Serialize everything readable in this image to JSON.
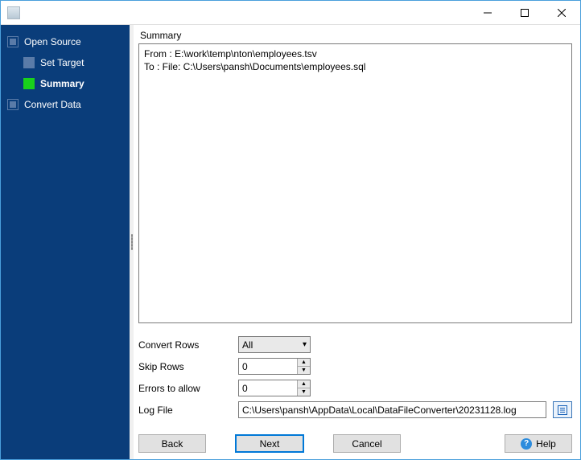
{
  "titlebar": {
    "title": ""
  },
  "sidebar": {
    "items": [
      {
        "label": "Open Source",
        "active": false,
        "child": false
      },
      {
        "label": "Set Target",
        "active": false,
        "child": true
      },
      {
        "label": "Summary",
        "active": true,
        "child": true
      },
      {
        "label": "Convert Data",
        "active": false,
        "child": false
      }
    ]
  },
  "main": {
    "section_label": "Summary",
    "summary_lines": {
      "line0": "From : E:\\work\\temp\\nton\\employees.tsv",
      "line1": "To : File: C:\\Users\\pansh\\Documents\\employees.sql"
    },
    "form": {
      "convert_rows": {
        "label": "Convert Rows",
        "value": "All"
      },
      "skip_rows": {
        "label": "Skip Rows",
        "value": "0"
      },
      "errors_allow": {
        "label": "Errors to allow",
        "value": "0"
      },
      "log_file": {
        "label": "Log File",
        "value": "C:\\Users\\pansh\\AppData\\Local\\DataFileConverter\\20231128.log"
      }
    }
  },
  "buttons": {
    "back": "Back",
    "next": "Next",
    "cancel": "Cancel",
    "help": "Help"
  }
}
